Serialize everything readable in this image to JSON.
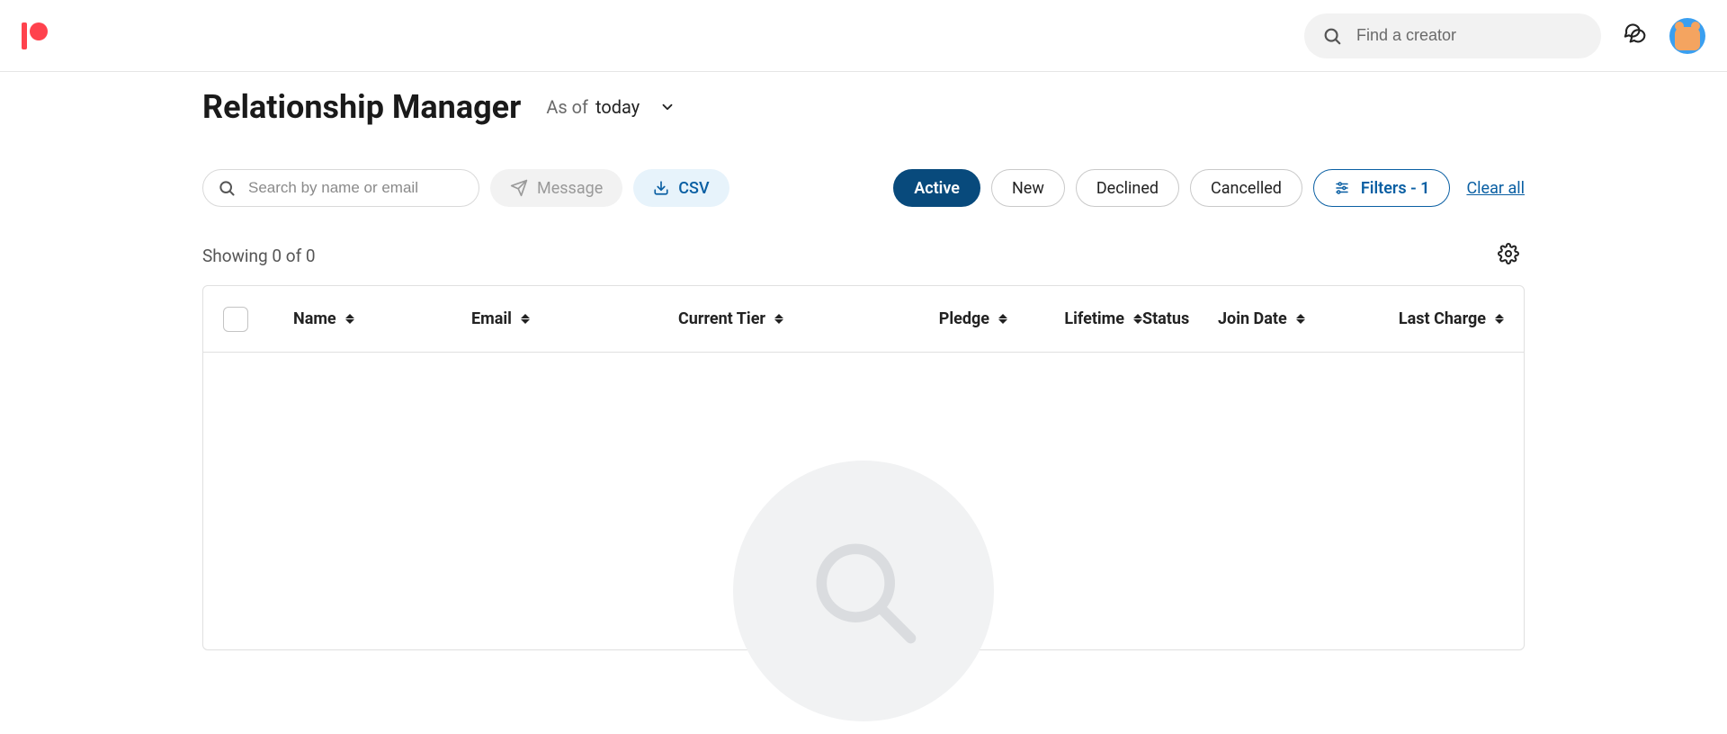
{
  "global_search_placeholder": "Find a creator",
  "page": {
    "title": "Relationship Manager",
    "asof_label": "As of",
    "asof_value": "today"
  },
  "local_search_placeholder": "Search by name or email",
  "buttons": {
    "message": "Message",
    "csv": "CSV",
    "clear_all": "Clear all"
  },
  "status_filters": {
    "active": "Active",
    "new": "New",
    "declined": "Declined",
    "cancelled": "Cancelled"
  },
  "filters_label": "Filters - 1",
  "showing_text": "Showing 0 of 0",
  "columns": {
    "name": "Name",
    "email": "Email",
    "tier": "Current Tier",
    "pledge": "Pledge",
    "lifetime": "Lifetime",
    "status": "Status",
    "join": "Join Date",
    "last": "Last Charge"
  }
}
